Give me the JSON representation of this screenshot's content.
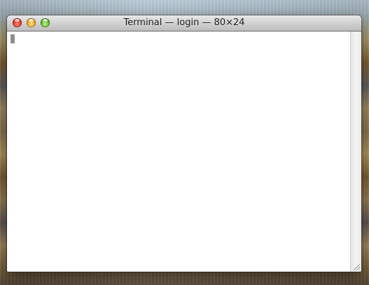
{
  "window": {
    "title": "Terminal — login — 80×24",
    "buttons": {
      "close": "close-button",
      "minimize": "minimize-button",
      "zoom": "zoom-button"
    }
  },
  "terminal": {
    "content": "",
    "cursor_visible": true
  },
  "colors": {
    "close": "#e0341f",
    "minimize": "#f0a21a",
    "zoom": "#57b52a",
    "cursor": "#8e8e8e",
    "background": "#ffffff"
  },
  "icons": [
    "close-icon",
    "minimize-icon",
    "zoom-icon",
    "resize-grip-icon"
  ]
}
